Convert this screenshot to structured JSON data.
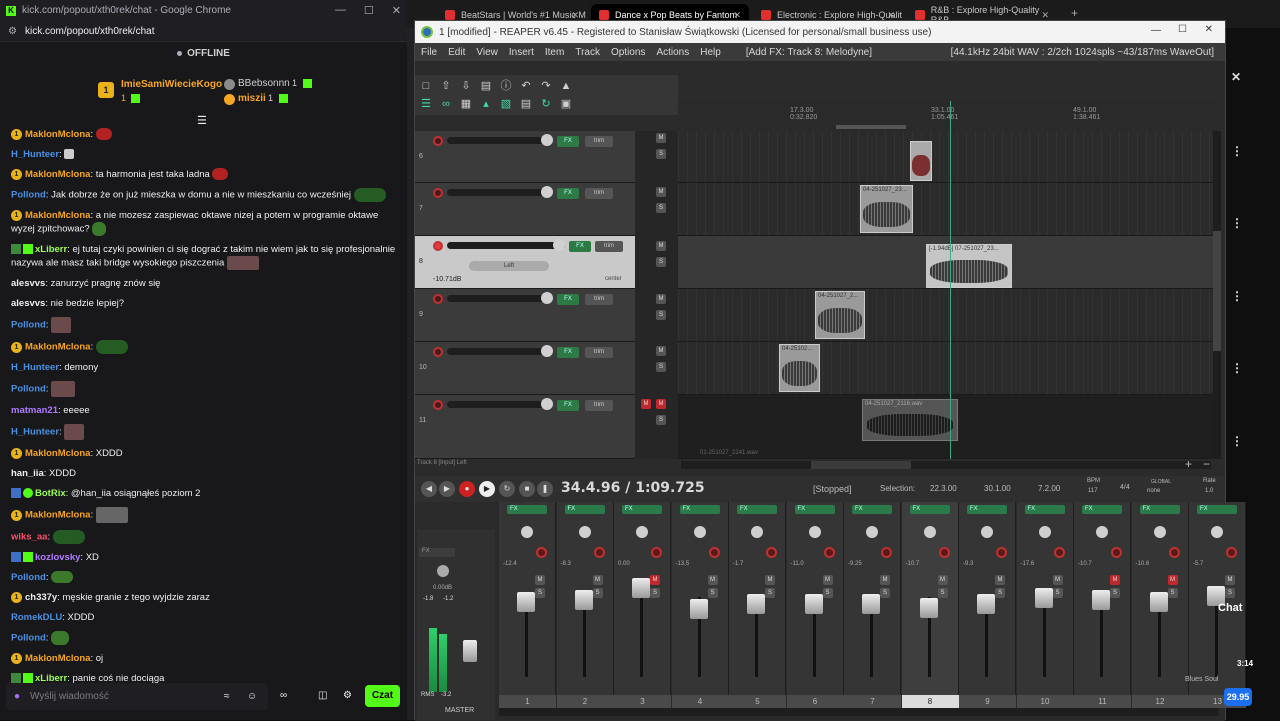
{
  "kick": {
    "window_title": "kick.com/popout/xth0rek/chat - Google Chrome",
    "url": "kick.com/popout/xth0rek/chat",
    "status": "OFFLINE",
    "leaders": [
      {
        "rank": "1",
        "name": "ImieSamiWiecieKogo",
        "count": "1",
        "color": "#f5a623"
      },
      {
        "rank": "",
        "name": "BBebsonnn",
        "count": "1",
        "color": "#cfcfcf"
      },
      {
        "rank": "",
        "name": "miszii",
        "count": "1",
        "color": "#f5a623"
      }
    ],
    "messages": [
      {
        "user": "MaklonMclona",
        "color": "#f5a623",
        "text": ":"
      },
      {
        "user": "H_Hunteer",
        "color": "#4a90e2",
        "text": ":"
      },
      {
        "user": "MaklonMclona",
        "color": "#f5a623",
        "text": ": ta harmonia jest taka ladna"
      },
      {
        "user": "Pollond",
        "color": "#4a90e2",
        "text": ": Jak dobrze że on już mieszka w domu a nie w mieszkaniu co wcześniej"
      },
      {
        "user": "MaklonMclona",
        "color": "#f5a623",
        "text": ": a nie mozesz zaspiewac oktawe nizej a potem w programie oktawe wyzej zpitchowac?"
      },
      {
        "user": "xLiberr",
        "color": "#9cff5a",
        "text": ": ej tutaj czyki powinien ci się dograć z takim nie wiem jak to się profesjonalnie nazywa ale masz taki bridge wysokiego piszczenia"
      },
      {
        "user": "alesvvs",
        "color": "#efeff1",
        "text": ": zanurzyć pragnę znów się"
      },
      {
        "user": "alesvvs",
        "color": "#efeff1",
        "text": ": nie bedzie lepiej?"
      },
      {
        "user": "Pollond",
        "color": "#4a90e2",
        "text": ":"
      },
      {
        "user": "MaklonMclona",
        "color": "#f5a623",
        "text": ":"
      },
      {
        "user": "H_Hunteer",
        "color": "#4a90e2",
        "text": ": demony"
      },
      {
        "user": "Pollond",
        "color": "#4a90e2",
        "text": ":"
      },
      {
        "user": "matman21",
        "color": "#b07cff",
        "text": ": eeeee"
      },
      {
        "user": "H_Hunteer",
        "color": "#4a90e2",
        "text": ":"
      },
      {
        "user": "MaklonMclona",
        "color": "#f5a623",
        "text": ": XDDD"
      },
      {
        "user": "han_iia",
        "color": "#efeff1",
        "text": ": XDDD"
      },
      {
        "user": "BotRix",
        "color": "#9cff5a",
        "text": ": @han_iia osiągnąłeś poziom 2"
      },
      {
        "user": "MaklonMclona",
        "color": "#f5a623",
        "text": ":"
      },
      {
        "user": "wiks_aa",
        "color": "#ff4d6d",
        "text": ":"
      },
      {
        "user": "kozlovsky",
        "color": "#b07cff",
        "text": ": XD"
      },
      {
        "user": "Pollond",
        "color": "#4a90e2",
        "text": ":"
      },
      {
        "user": "ch337y",
        "color": "#efeff1",
        "text": ": męskie granie z tego wyjdzie zaraz"
      },
      {
        "user": "RomekDLU",
        "color": "#4a90e2",
        "text": ": XDDD"
      },
      {
        "user": "Pollond",
        "color": "#4a90e2",
        "text": ":"
      },
      {
        "user": "MaklonMclona",
        "color": "#f5a623",
        "text": ": oj"
      },
      {
        "user": "xLiberr",
        "color": "#9cff5a",
        "text": ": panie coś nie dociąga"
      }
    ],
    "composer_placeholder": "Wyślij wiadomość",
    "chat_button": "Czat"
  },
  "chrome_tabs": [
    {
      "label": "BeatStars | World's #1 Music M",
      "active": false
    },
    {
      "label": "Dance x Pop Beats by Fantom",
      "active": true
    },
    {
      "label": "Electronic : Explore High-Qualit",
      "active": false
    },
    {
      "label": "R&B : Explore High-Quality R&B",
      "active": false
    }
  ],
  "reaper": {
    "title": "1 [modified] - REAPER v6.45 - Registered to Stanisław Świątkowski (Licensed for personal/small business use)",
    "menu": [
      "File",
      "Edit",
      "View",
      "Insert",
      "Item",
      "Track",
      "Options",
      "Actions",
      "Help"
    ],
    "menu_status": "[Add FX: Track 8: Melodyne]",
    "audio_status": "[44.1kHz 24bit WAV : 2/2ch 1024spls ~43/187ms WaveOut]",
    "ruler": [
      {
        "bar": "17.3.00",
        "time": "0:32.820"
      },
      {
        "bar": "33.1.00",
        "time": "1:05.461"
      },
      {
        "bar": "49.1.00",
        "time": "1:38.461"
      }
    ],
    "tracks": [
      {
        "num": "6",
        "selected": false,
        "armed": false
      },
      {
        "num": "7",
        "selected": false,
        "armed": false
      },
      {
        "num": "8",
        "selected": true,
        "armed": true,
        "vol": "-10.71dB",
        "pan": "center",
        "send": "Left"
      },
      {
        "num": "9",
        "selected": false,
        "armed": false
      },
      {
        "num": "10",
        "selected": false,
        "armed": false
      },
      {
        "num": "11",
        "selected": false,
        "armed": false,
        "muted": true
      }
    ],
    "clips": [
      {
        "label": "04-251027_23...",
        "lane": 1
      },
      {
        "label": "[-1.94dB] 07-251027_23...",
        "lane": 2
      },
      {
        "label": "04-251027_2...",
        "lane": 3
      },
      {
        "label": "04-25102...",
        "lane": 4
      },
      {
        "label": "04-251027_2116.wav",
        "lane": 5
      }
    ],
    "footer_left": "Track 8 [Input] Left",
    "footer_file": "01-251027_2241.wav",
    "transport": {
      "position": "34.4.96 / 1:09.725",
      "state": "[Stopped]",
      "selection_label": "Selection:",
      "sel_start": "22.3.00",
      "sel_end": "30.1.00",
      "sel_len": "7.2.00",
      "bpm_label": "BPM",
      "bpm": "117",
      "timesig": "4/4",
      "global_label": "GLOBAL",
      "global_val": "none",
      "rate_label": "Rate",
      "rate_val": "1.0"
    },
    "mixer": {
      "master_label": "MASTER",
      "master_vol": "0.00dB",
      "master_peaks": [
        "-1.8",
        "-1.2"
      ],
      "rms_label": "RMS",
      "rms_val": "-3.2",
      "channels": [
        {
          "num": "1",
          "vol": "-12.4",
          "muted": false,
          "armed": true
        },
        {
          "num": "2",
          "vol": "-8.3",
          "muted": false,
          "armed": true
        },
        {
          "num": "3",
          "vol": "0.00",
          "muted": true,
          "armed": true
        },
        {
          "num": "4",
          "vol": "-13.5",
          "muted": false,
          "armed": true
        },
        {
          "num": "5",
          "vol": "-1.7",
          "muted": false,
          "armed": true
        },
        {
          "num": "6",
          "vol": "-11.0",
          "muted": false,
          "armed": true
        },
        {
          "num": "7",
          "vol": "-9.25",
          "muted": false,
          "armed": true
        },
        {
          "num": "8",
          "vol": "-10.7",
          "muted": false,
          "armed": true,
          "selected": true
        },
        {
          "num": "9",
          "vol": "-9.3",
          "muted": false,
          "armed": true
        },
        {
          "num": "10",
          "vol": "-17.6",
          "muted": false,
          "armed": true
        },
        {
          "num": "11",
          "vol": "-10.7",
          "muted": true,
          "armed": true
        },
        {
          "num": "12",
          "vol": "-10.6",
          "muted": true,
          "armed": true
        },
        {
          "num": "13",
          "vol": "-5.7",
          "muted": false,
          "armed": true
        }
      ],
      "strip_label": "Blues Soul"
    }
  },
  "overlay": {
    "chat_label": "Chat",
    "time": "3:14",
    "price": "29.95"
  }
}
